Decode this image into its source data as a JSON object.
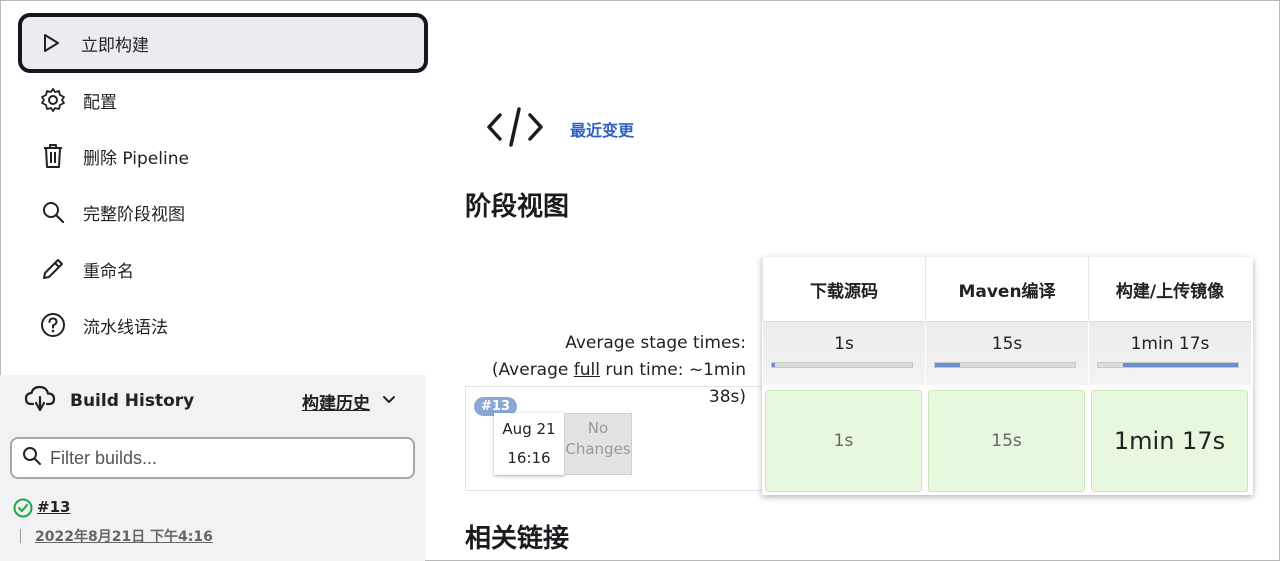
{
  "sidebar": {
    "tasks": [
      {
        "label": "立即构建",
        "icon": "play-icon"
      },
      {
        "label": "配置",
        "icon": "gear-icon"
      },
      {
        "label": "删除 Pipeline",
        "icon": "trash-icon"
      },
      {
        "label": "完整阶段视图",
        "icon": "search-icon"
      },
      {
        "label": "重命名",
        "icon": "pencil-icon"
      },
      {
        "label": "流水线语法",
        "icon": "help-icon"
      }
    ],
    "build_history": {
      "title": "Build History",
      "trend_label": "构建历史",
      "filter_placeholder": "Filter builds...",
      "builds": [
        {
          "number": "#13",
          "date": "2022年8月21日 下午4:16",
          "status": "success"
        }
      ]
    }
  },
  "main": {
    "recent_changes_label": "最近变更",
    "stage_view_title": "阶段视图",
    "related_links_title": "相关链接",
    "average": {
      "line1": "Average stage times:",
      "line2_prefix": "(Average ",
      "line2_link": "full",
      "line2_suffix": " run time: ~1min 38s)"
    },
    "run": {
      "badge": "#13",
      "date": "Aug 21",
      "time": "16:16",
      "changes_line1": "No",
      "changes_line2": "Changes"
    },
    "stages": [
      {
        "name": "下载源码",
        "avg": "1s",
        "avg_fraction_start": 0.0,
        "avg_fraction": 0.02,
        "run_duration": "1s"
      },
      {
        "name": "Maven编译",
        "avg": "15s",
        "avg_fraction_start": 0.0,
        "avg_fraction": 0.18,
        "run_duration": "15s"
      },
      {
        "name": "构建/上传镜像",
        "avg": "1min 17s",
        "avg_fraction_start": 0.18,
        "avg_fraction": 0.82,
        "run_duration": "1min 17s"
      }
    ]
  },
  "colors": {
    "accent_link": "#2f63c4",
    "success": "#1ea64b",
    "stage_success_bg": "#e7f8df",
    "bar_fill": "#6b8fd6",
    "badge": "#8aa8d6"
  }
}
